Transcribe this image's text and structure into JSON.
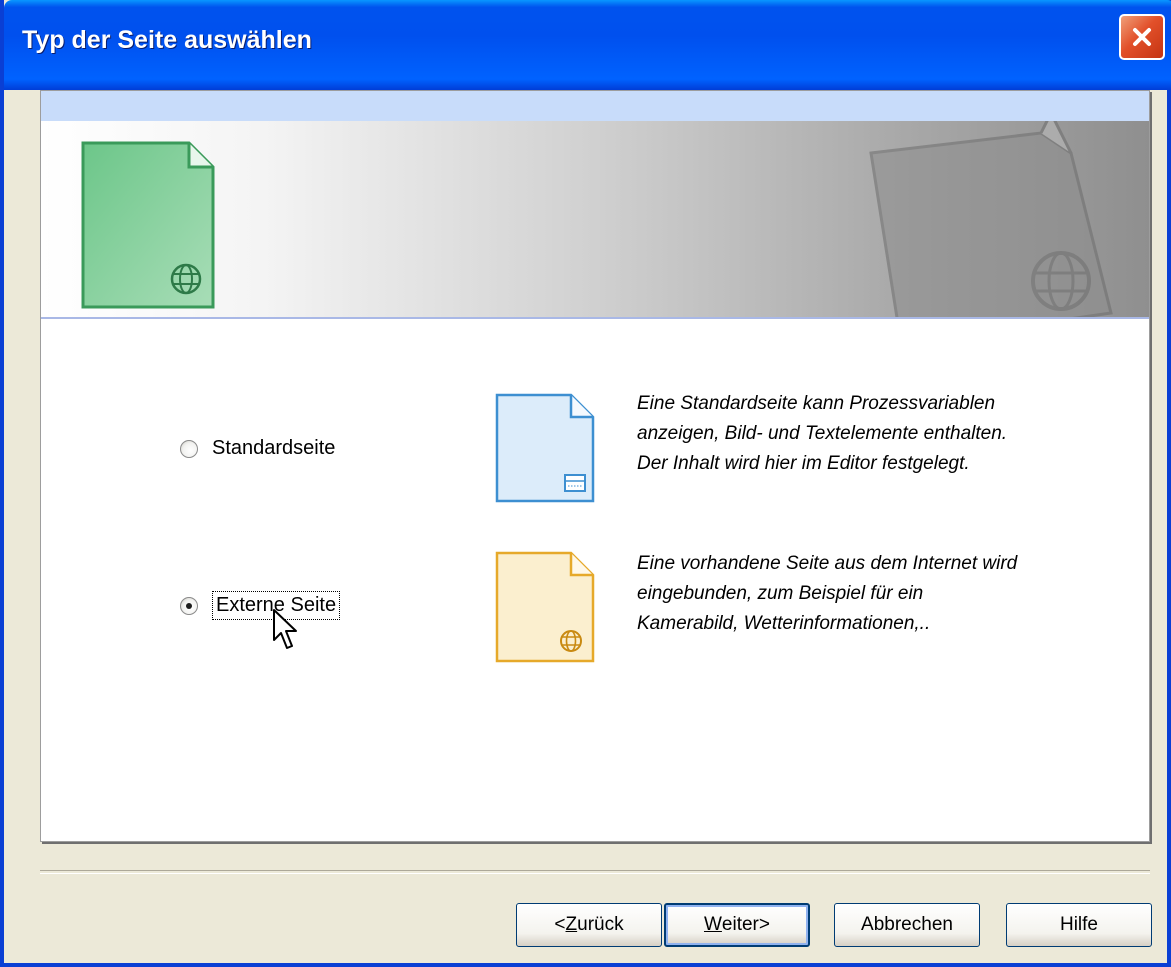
{
  "window": {
    "title": "Typ der Seite auswählen"
  },
  "options": [
    {
      "label": "Standardseite",
      "checked": false,
      "description": [
        "Eine Standardseite kann Prozessvariablen",
        "anzeigen, Bild- und Textelemente enthalten.",
        "Der Inhalt wird hier im Editor festgelegt."
      ],
      "icon": "standard-page-icon",
      "color": "#3d8fd1"
    },
    {
      "label": "Externe Seite",
      "checked": true,
      "description": [
        "Eine vorhandene Seite aus dem Internet wird",
        "eingebunden, zum Beispiel für ein",
        "Kamerabild, Wetterinformationen,.."
      ],
      "icon": "external-page-icon",
      "color": "#e6a92a"
    }
  ],
  "buttons": {
    "back": {
      "prefix": "< ",
      "key": "Z",
      "rest": "urück"
    },
    "next": {
      "key": "W",
      "rest": "eiter",
      "suffix": " >"
    },
    "cancel": "Abbrechen",
    "help": "Hilfe"
  },
  "colors": {
    "titlebar": "#0053ee",
    "banner_icon": "#5cb87a",
    "header_strip": "#c8dcfa"
  }
}
